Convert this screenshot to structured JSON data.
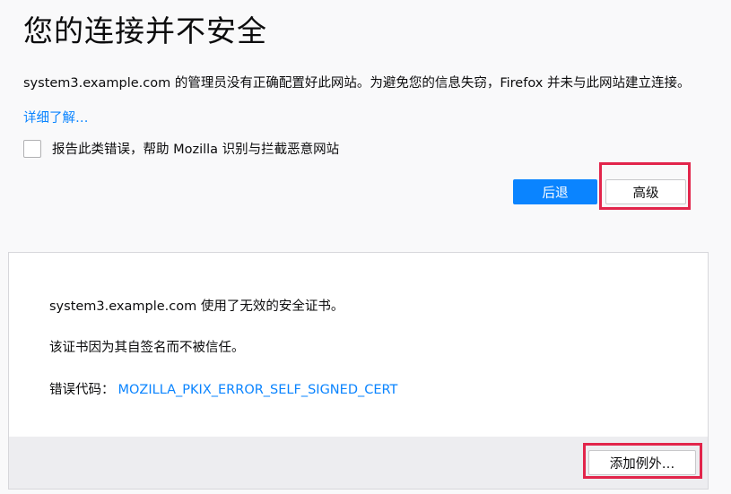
{
  "page": {
    "title": "您的连接并不安全",
    "description": "system3.example.com 的管理员没有正确配置好此网站。为避免您的信息失窃，Firefox 并未与此网站建立连接。",
    "learn_more": "详细了解…",
    "report_label": "报告此类错误，帮助 Mozilla 识别与拦截恶意网站",
    "report_checked": false
  },
  "buttons": {
    "back": "后退",
    "advanced": "高级",
    "add_exception": "添加例外…"
  },
  "advanced_panel": {
    "line1": "system3.example.com 使用了无效的安全证书。",
    "line2": "该证书因为其自签名而不被信任。",
    "error_code_label": "错误代码：",
    "error_code": "MOZILLA_PKIX_ERROR_SELF_SIGNED_CERT"
  },
  "colors": {
    "accent": "#0a84ff",
    "highlight": "#e2254b",
    "background": "#f9f9fa"
  }
}
